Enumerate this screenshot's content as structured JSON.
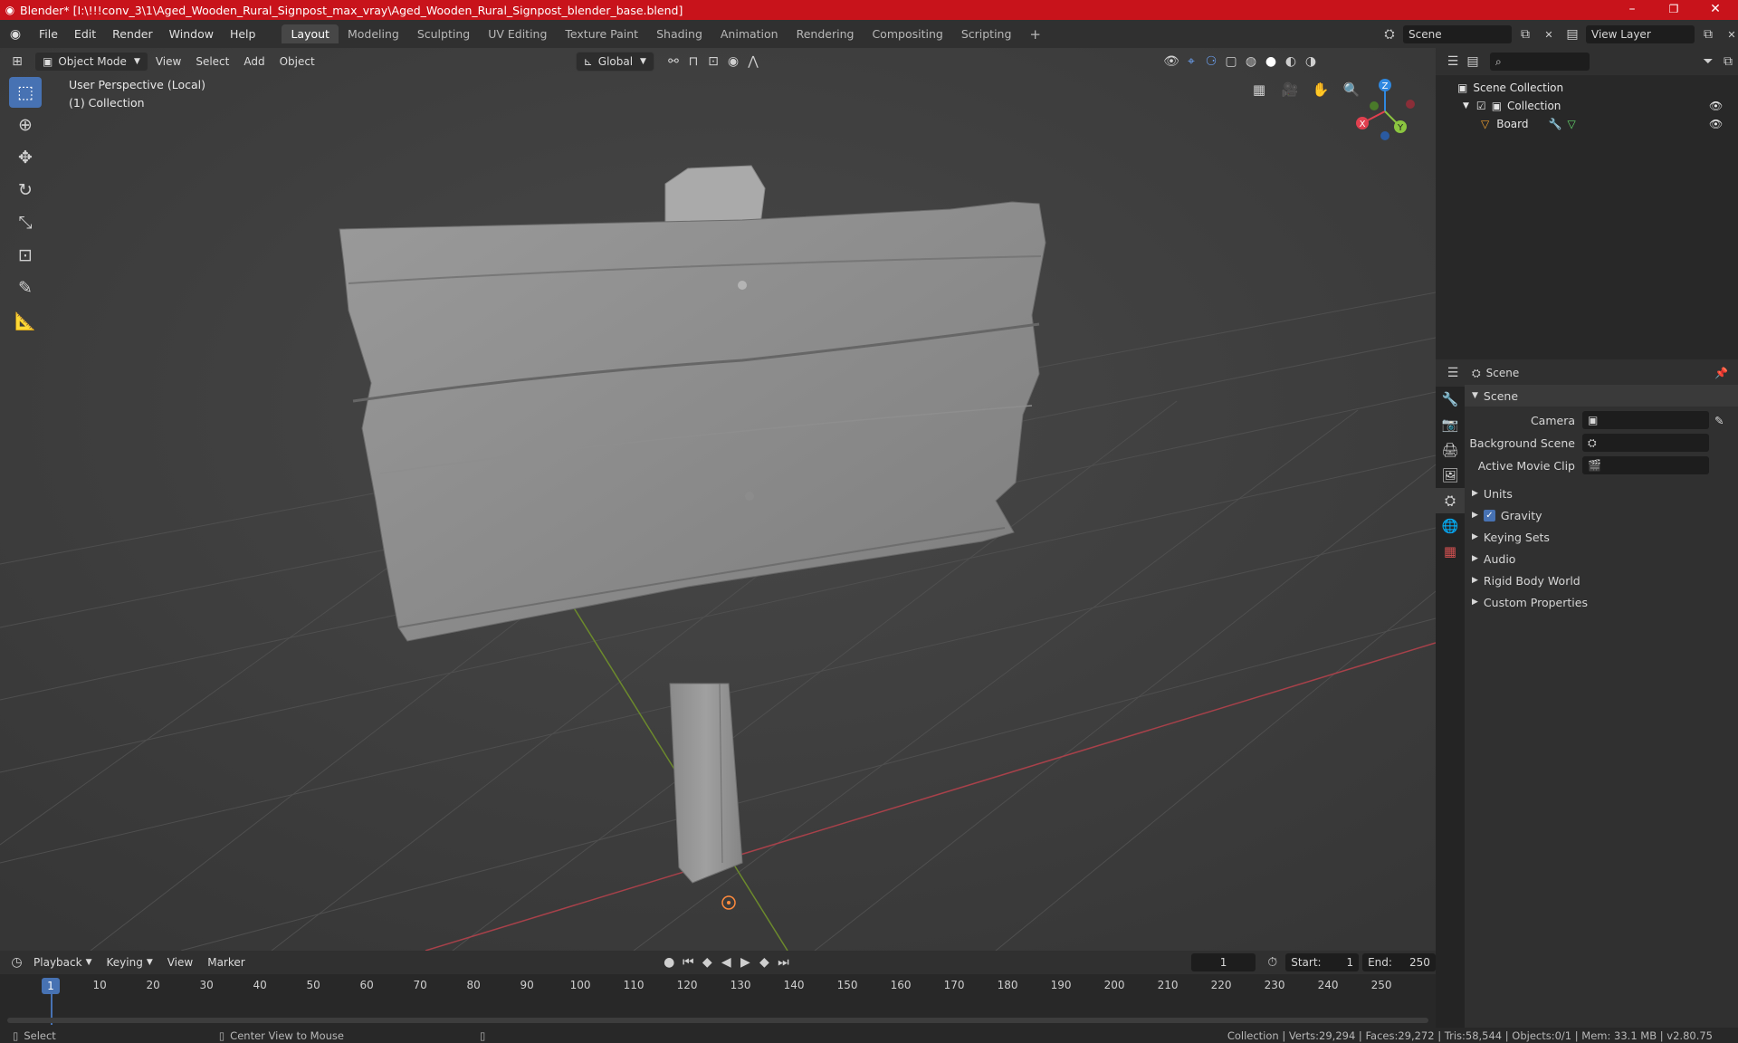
{
  "window": {
    "title": "Blender* [I:\\!!!conv_3\\1\\Aged_Wooden_Rural_Signpost_max_vray\\Aged_Wooden_Rural_Signpost_blender_base.blend]",
    "controls": [
      "–",
      "❐",
      "✕"
    ]
  },
  "menu": {
    "items": [
      "File",
      "Edit",
      "Render",
      "Window",
      "Help"
    ]
  },
  "workspace_tabs": [
    "Layout",
    "Modeling",
    "Sculpting",
    "UV Editing",
    "Texture Paint",
    "Shading",
    "Animation",
    "Rendering",
    "Compositing",
    "Scripting"
  ],
  "active_tab": "Layout",
  "scene_selector": {
    "value": "Scene"
  },
  "view_layer_selector": {
    "value": "View Layer"
  },
  "viewport_header": {
    "mode": "Object Mode",
    "menus": [
      "View",
      "Select",
      "Add",
      "Object"
    ],
    "orientation": "Global"
  },
  "viewport": {
    "perspective": "User Perspective (Local)",
    "collection": "(1) Collection",
    "gizmo": {
      "x": "X",
      "y": "Y",
      "z": "Z"
    }
  },
  "outliner": {
    "search_placeholder": "",
    "root": "Scene Collection",
    "collection": "Collection",
    "object": "Board"
  },
  "properties": {
    "header": "Scene",
    "panel": "Scene",
    "fields": {
      "camera": "Camera",
      "background_scene": "Background Scene",
      "active_movie_clip": "Active Movie Clip"
    },
    "sections": [
      "Units",
      "Gravity",
      "Keying Sets",
      "Audio",
      "Rigid Body World",
      "Custom Properties"
    ],
    "gravity_checked": true
  },
  "timeline": {
    "menus": [
      "Playback",
      "Keying",
      "View",
      "Marker"
    ],
    "current_frame": "1",
    "start_label": "Start:",
    "start": "1",
    "end_label": "End:",
    "end": "250",
    "ruler": [
      "10",
      "20",
      "30",
      "40",
      "50",
      "60",
      "70",
      "80",
      "90",
      "100",
      "110",
      "120",
      "130",
      "140",
      "150",
      "160",
      "170",
      "180",
      "190",
      "200",
      "210",
      "220",
      "230",
      "240",
      "250"
    ],
    "playhead": "1"
  },
  "statusbar": {
    "left": "Select",
    "middle": "Center View to Mouse",
    "stats": "Collection | Verts:29,294 | Faces:29,272 | Tris:58,544 | Objects:0/1 | Mem: 33.1 MB | v2.80.75"
  },
  "colors": {
    "titlebar": "#c8131b",
    "accent": "#4772b3",
    "axis_x": "#e0404f",
    "axis_y": "#8bc540",
    "axis_z": "#2f88e0"
  }
}
